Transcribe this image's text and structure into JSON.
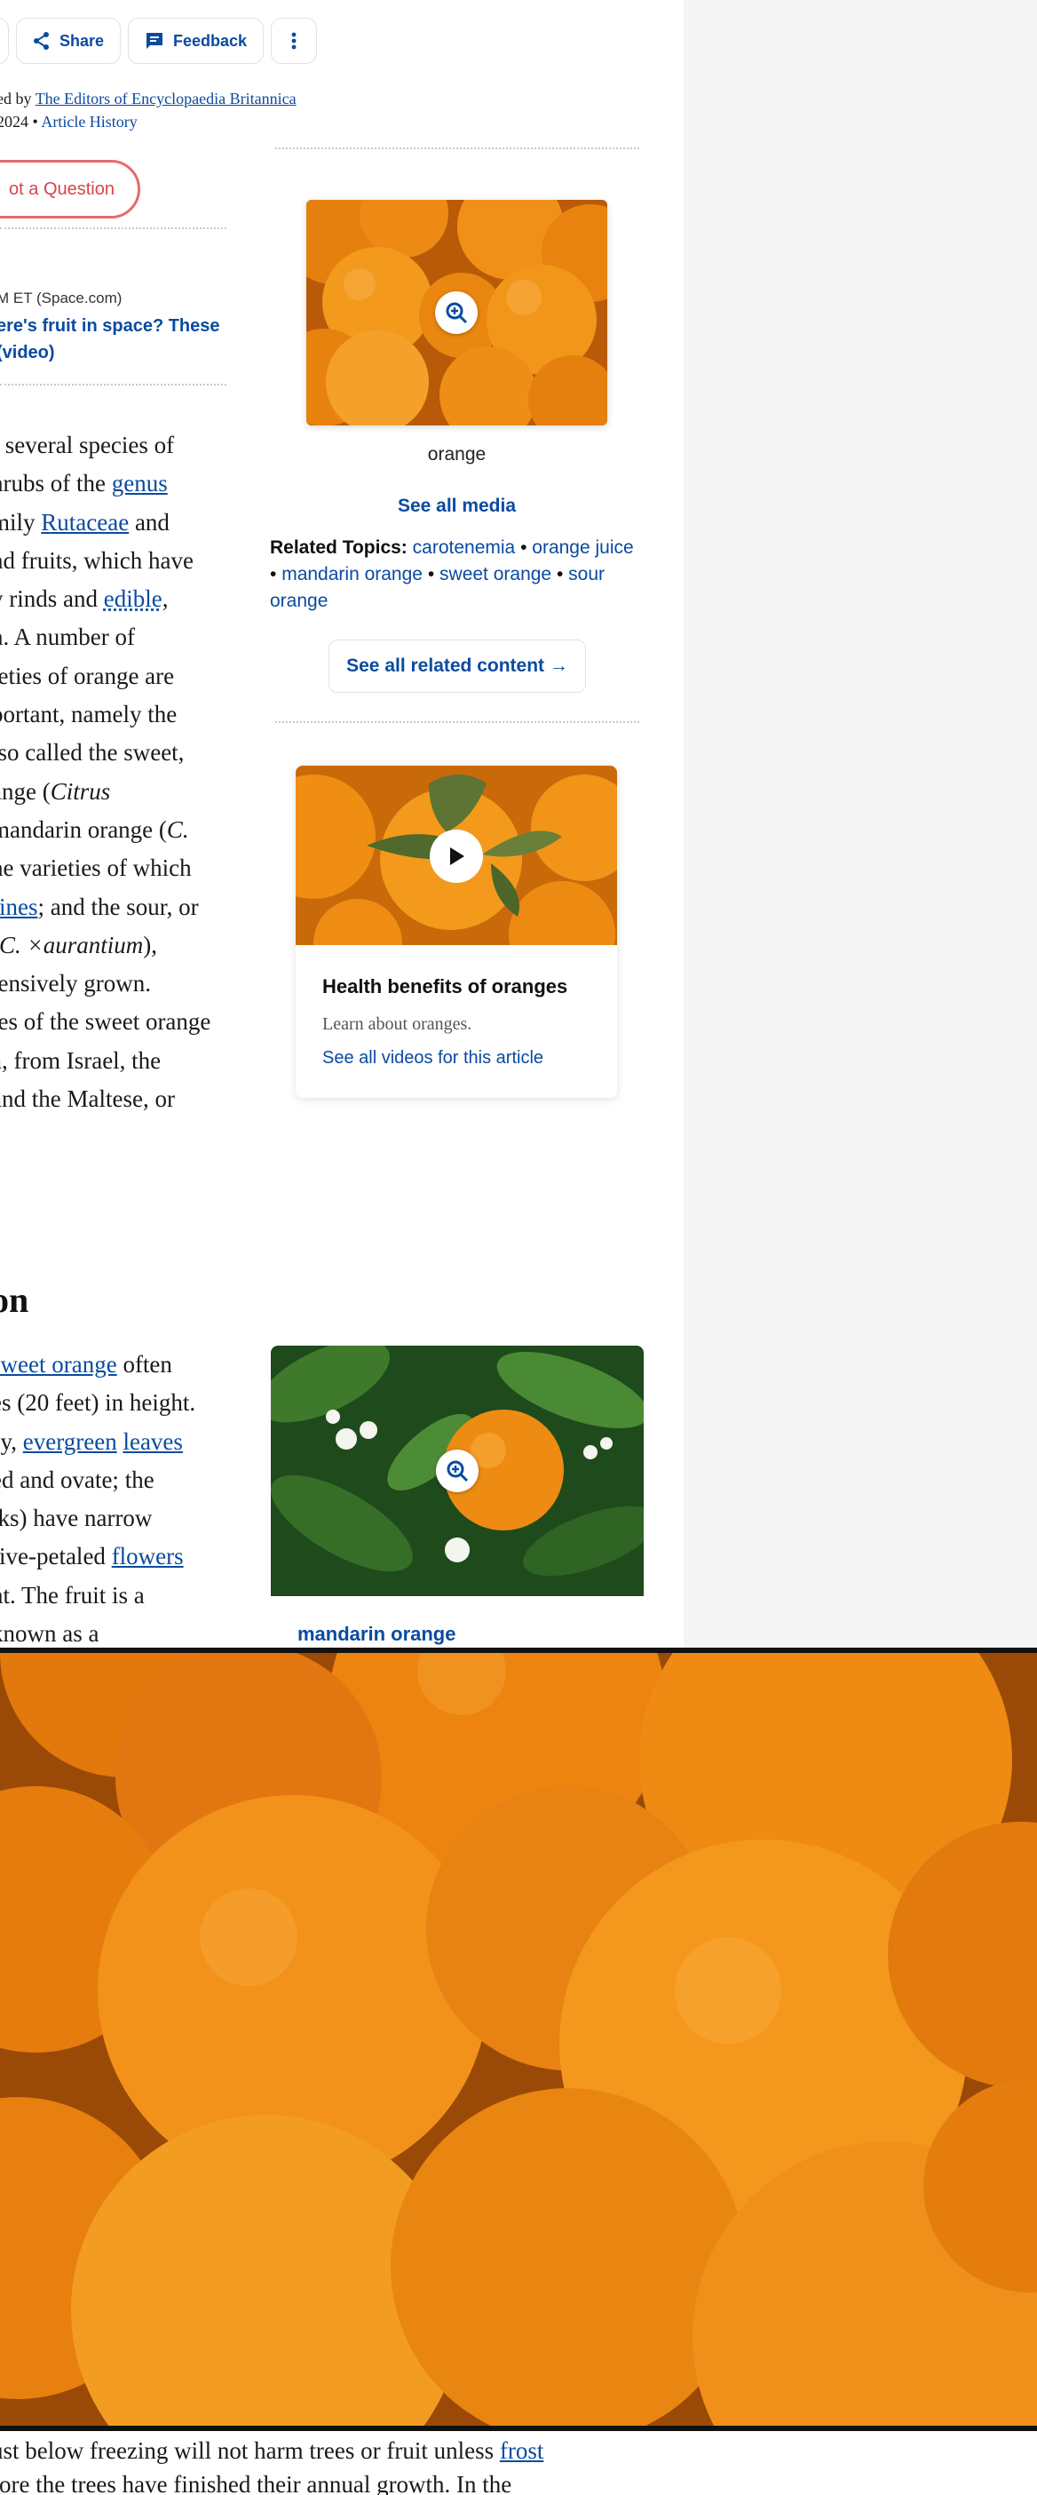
{
  "toolbar": {
    "share_label": "Share",
    "feedback_label": "Feedback"
  },
  "byline": {
    "prefix": "ed by",
    "editors_link": "The Editors of Encyclopaedia Britannica",
    "date_fragment": "2024",
    "bullet": "•",
    "history_link": "Article History"
  },
  "ask_button": "ot a Question",
  "news": {
    "meta": "M ET (Space.com)",
    "line1": "ere's fruit in space? These",
    "line2": "(video)"
  },
  "article": {
    "l1": "f several species of",
    "l2a": "hrubs of the ",
    "l2link": "genus",
    "l3a": "mily ",
    "l3link": "Rutaceae",
    "l3b": " and",
    "l4": "nd fruits, which have",
    "l5a": "y rinds and ",
    "l5link": "edible",
    "l5b": ",",
    "l6": "n. A number of",
    "l7": "ieties of orange are",
    "l8": "portant, namely the",
    "l9": "lso called the sweet,",
    "l10a": "ange (",
    "l10i": "Citrus",
    "l11a": "mandarin orange (",
    "l11i": "C.",
    "l12": "he varieties of which",
    "l13link": "rines",
    "l13b": "; and the sour, or",
    "l14a": "(",
    "l14i": "C. ×aurantium",
    "l14b": "),",
    "l15": "tensively grown.",
    "l16": "ies of the sweet orange",
    "l17": "a, from Israel, the",
    "l18": "and the Maltese, or"
  },
  "section2": {
    "heading": "on",
    "l1link": "sweet orange",
    "l1b": " often",
    "l2": "es (20 feet) in height.",
    "l3a": "sy, ",
    "l3link1": "evergreen",
    "l3link2": "leaves",
    "l4": "ed and ovate; the",
    "l5": "lks) have narrow",
    "l6a": " five-petaled ",
    "l6link": "flowers",
    "l7": "nt. The fruit is a",
    "l8": "known as a"
  },
  "sidebar": {
    "media_caption": "orange",
    "see_all_media": "See all media",
    "related_label": "Related Topics:",
    "related": [
      "carotenemia",
      "orange juice",
      "mandarin orange",
      "sweet orange",
      "sour orange"
    ],
    "see_all_related": "See all related content →",
    "video": {
      "title": "Health benefits of oranges",
      "description": "Learn about oranges.",
      "link": "See all videos for this article"
    },
    "mandarin_title": "mandarin orange"
  },
  "bottom": {
    "l1a": "ust below freezing will not harm trees or fruit unless ",
    "l1link": "frost",
    "l2": "fore the trees have finished their annual growth. In the"
  },
  "colors": {
    "link": "#0a4ba0",
    "ask_border": "#e56a6f",
    "orange": "#f08a12"
  }
}
